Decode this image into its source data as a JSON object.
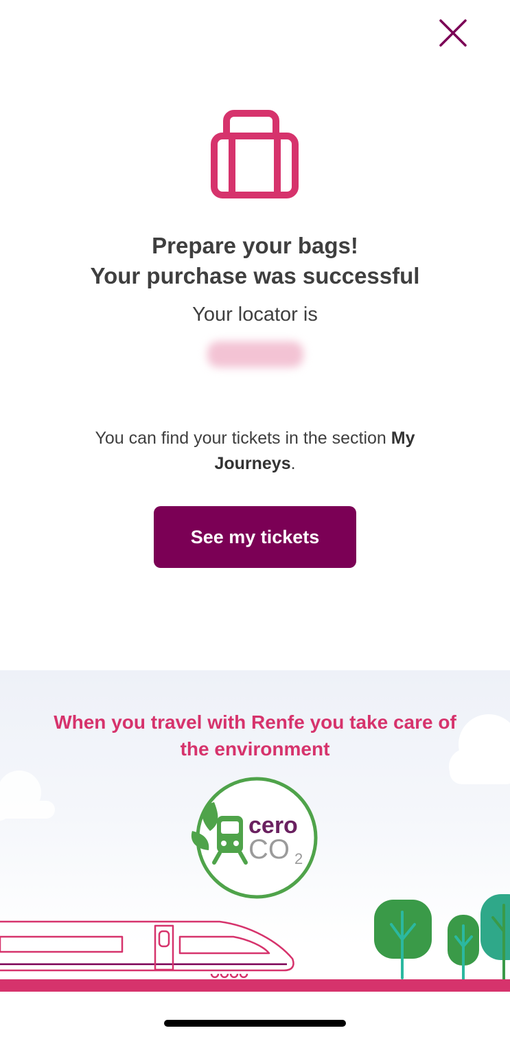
{
  "dialog": {
    "title_line1": "Prepare your bags!",
    "title_line2": "Your purchase was successful",
    "locator_label": "Your locator is",
    "locator_value": "",
    "info_prefix": "You can find your tickets in the section ",
    "info_section": "My Journeys",
    "info_suffix": ".",
    "primary_button": "See my tickets"
  },
  "eco_banner": {
    "text": "When you travel with Renfe you take care of the environment",
    "badge_word": "cero",
    "badge_co": "CO",
    "badge_sub": "2"
  },
  "colors": {
    "brand_purple": "#7b0055",
    "accent_pink": "#d6336c",
    "text_dark": "#3f3f3f",
    "eco_green": "#4fa34a"
  },
  "icons": [
    "close-icon",
    "suitcase-icon",
    "leaf-icon",
    "train-icon",
    "tree-icon",
    "cloud-icon"
  ]
}
